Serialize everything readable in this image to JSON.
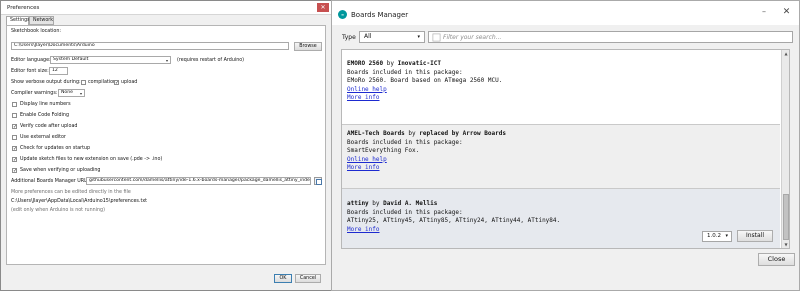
{
  "preferences": {
    "title": "Preferences",
    "tabs": [
      "Settings",
      "Network"
    ],
    "sketchbook_label": "Sketchbook location:",
    "sketchbook_path": "C:\\Users\\Jlayer\\Documents\\Arduino",
    "browse_label": "Browse",
    "editor_language_label": "Editor language:",
    "editor_language_value": "System Default",
    "restart_note": "(requires restart of Arduino)",
    "font_size_label": "Editor font size:",
    "font_size_value": "12",
    "verbose_label": "Show verbose output during:",
    "verbose_options": [
      {
        "label": "compilation",
        "checked": false
      },
      {
        "label": "upload",
        "checked": true
      }
    ],
    "compiler_warnings_label": "Compiler warnings:",
    "compiler_warnings_value": "None",
    "checkboxes": [
      {
        "label": "Display line numbers",
        "checked": false
      },
      {
        "label": "Enable Code Folding",
        "checked": false
      },
      {
        "label": "Verify code after upload",
        "checked": true
      },
      {
        "label": "Use external editor",
        "checked": false
      },
      {
        "label": "Check for updates on startup",
        "checked": true
      },
      {
        "label": "Update sketch files to new extension on save (.pde -> .ino)",
        "checked": true
      },
      {
        "label": "Save when verifying or uploading",
        "checked": true
      }
    ],
    "boards_url_label": "Additional Boards Manager URLs:",
    "boards_url_value": "githubusercontent.com/damellis/attiny/ide-1.6.x-boards-manager/package_damellis_attiny_index.json",
    "more_prefs_note": "More preferences can be edited directly in the file",
    "prefs_file_path": "C:\\Users\\Jlayer\\AppData\\Local\\Arduino15\\preferences.txt",
    "edit_note": "(edit only when Arduino is not running)",
    "ok_label": "OK",
    "cancel_label": "Cancel"
  },
  "boards_manager": {
    "title": "Boards Manager",
    "logo_text": "∞",
    "type_label": "Type",
    "type_value": "All",
    "search_placeholder": "Filter your search...",
    "items": [
      {
        "name": "EMORO 2560",
        "by": " by ",
        "author": "Inovatic-ICT",
        "included_label": "Boards included in this package:",
        "boards": "EMoRo 2560. Board based on ATmega 2560 MCU.",
        "online_help": "Online help",
        "more_info": "More info"
      },
      {
        "name": "AMEL-Tech Boards",
        "by": " by ",
        "author": "replaced by Arrow Boards",
        "included_label": "Boards included in this package:",
        "boards": "SmartEverything Fox.",
        "online_help": "Online help",
        "more_info": "More info"
      },
      {
        "name": "attiny",
        "by": " by ",
        "author": "David A. Mellis",
        "included_label": "Boards included in this package:",
        "boards": "ATtiny25, ATtiny45, ATtiny85, ATtiny24, ATtiny44, ATtiny84.",
        "more_info": "More info"
      }
    ],
    "version_value": "1.0.2",
    "install_label": "Install",
    "close_label": "Close"
  }
}
